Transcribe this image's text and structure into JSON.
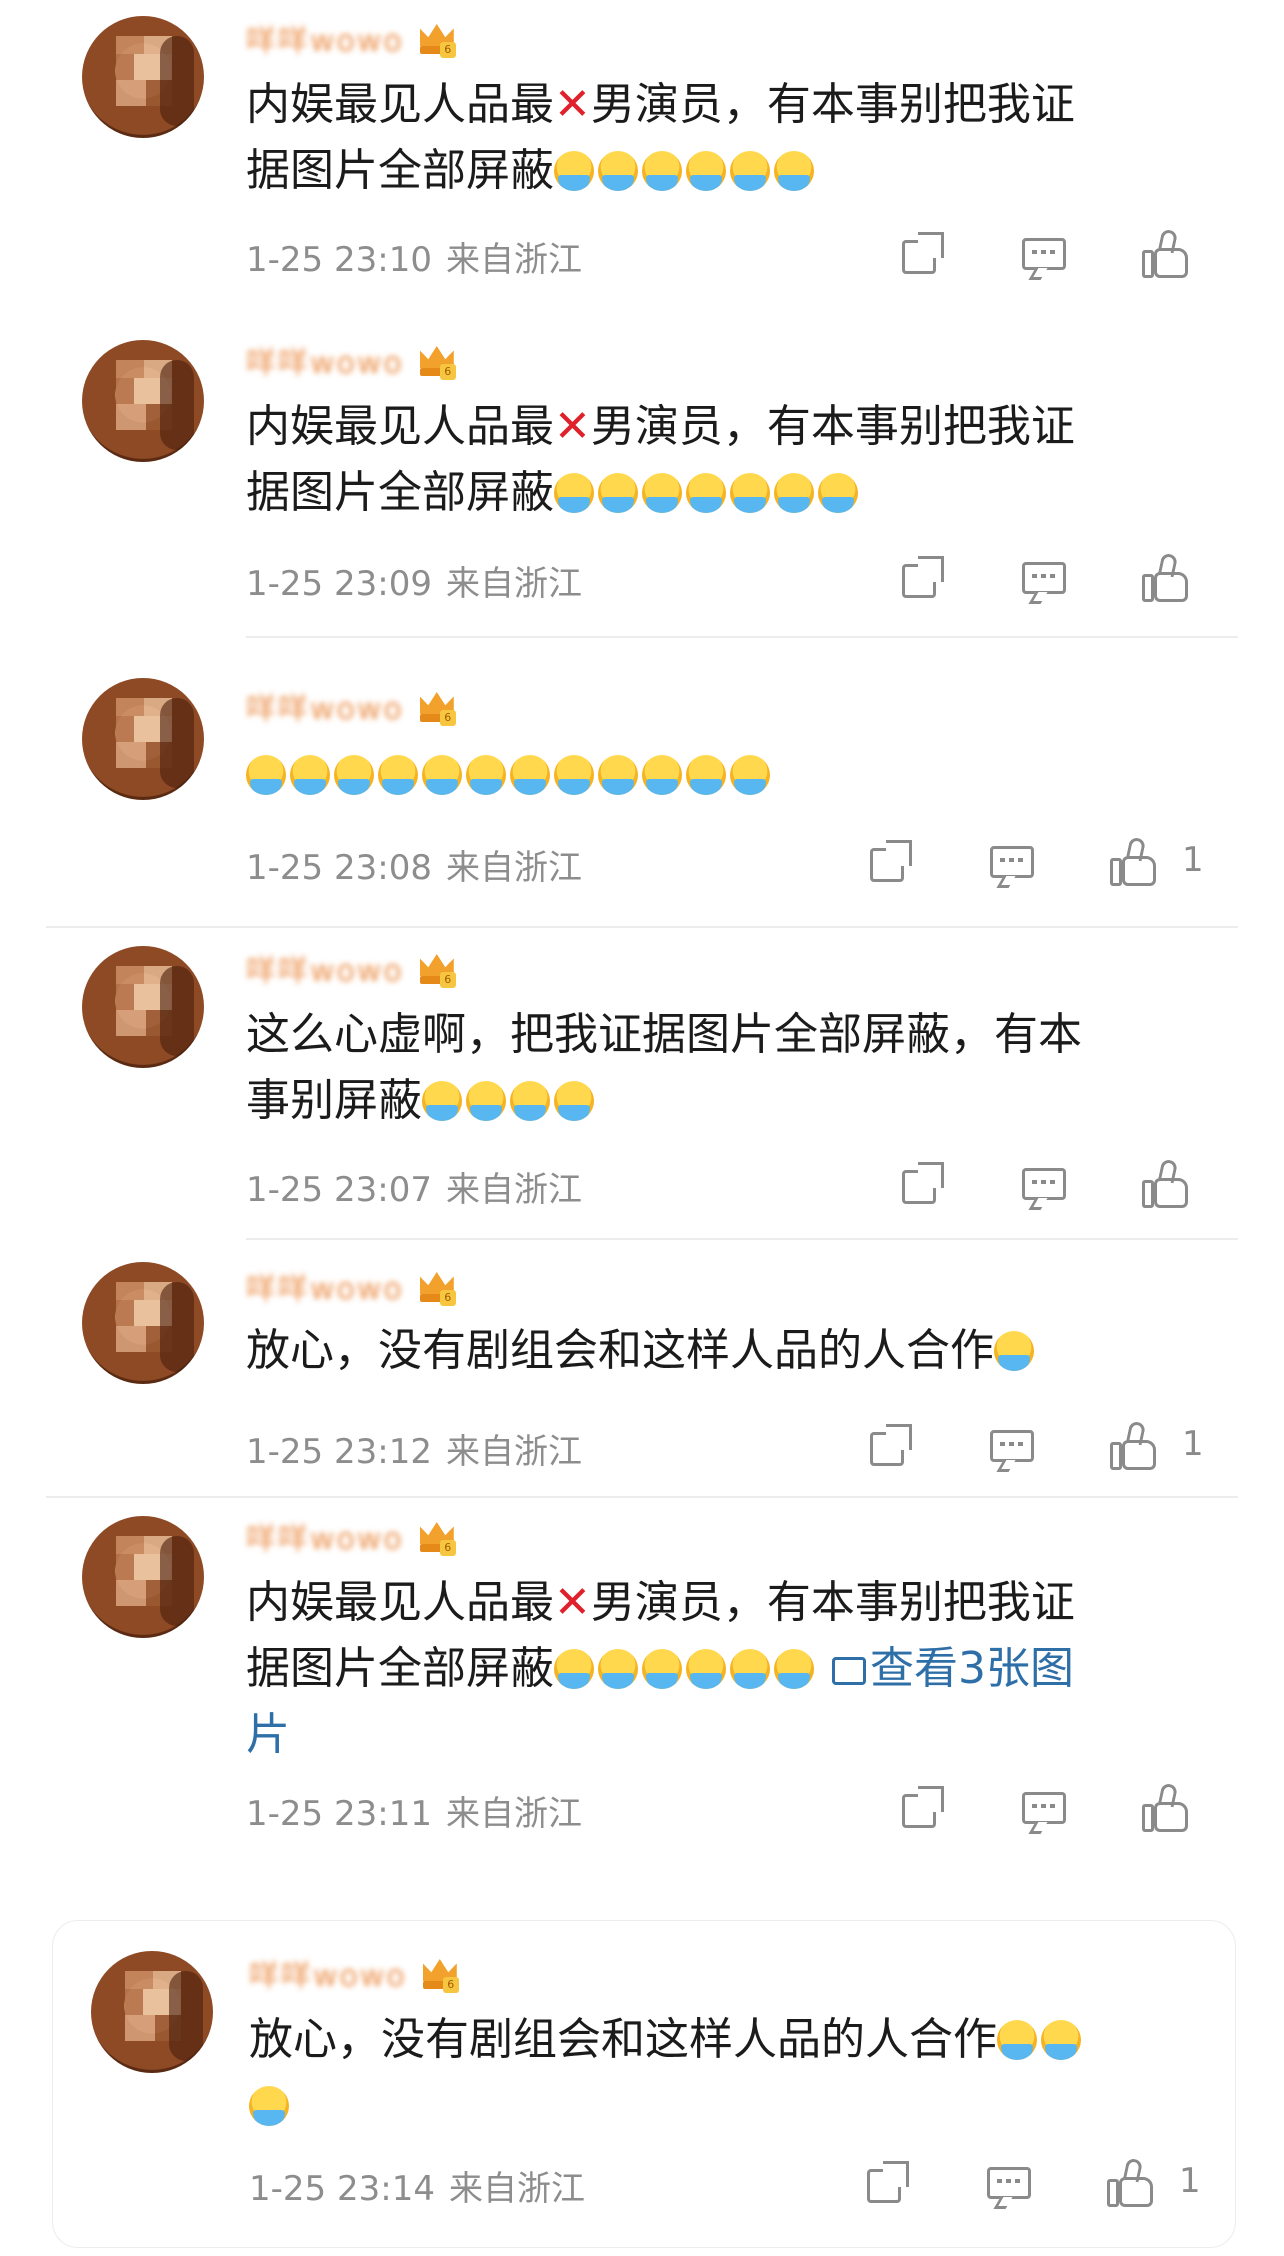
{
  "comments": [
    {
      "user": "咩咩wowo",
      "text": [
        "内娱最见人品最",
        "✕",
        "男演员，有本事别把我证",
        "据图片全部屏蔽"
      ],
      "emoji_count": 6,
      "time": "1-25 23:10",
      "location": "来自浙江",
      "likes": ""
    },
    {
      "user": "咩咩wowo",
      "text": [
        "内娱最见人品最",
        "✕",
        "男演员，有本事别把我证",
        "据图片全部屏蔽"
      ],
      "emoji_count": 7,
      "time": "1-25 23:09",
      "location": "来自浙江",
      "likes": ""
    },
    {
      "user": "咩咩wowo",
      "text": [
        ""
      ],
      "emoji_count": 12,
      "time": "1-25 23:08",
      "location": "来自浙江",
      "likes": "1"
    },
    {
      "user": "咩咩wowo",
      "text": [
        "这么心虚啊，把我证据图片全部屏蔽，有本",
        "事别屏蔽"
      ],
      "emoji_count": 4,
      "time": "1-25 23:07",
      "location": "来自浙江",
      "likes": ""
    },
    {
      "user": "咩咩wowo",
      "text": [
        "放心，没有剧组会和这样人品的人合作"
      ],
      "emoji_count": 1,
      "time": "1-25 23:12",
      "location": "来自浙江",
      "likes": "1"
    },
    {
      "user": "咩咩wowo",
      "text": [
        "内娱最见人品最",
        "✕",
        "男演员，有本事别把我证",
        "据图片全部屏蔽"
      ],
      "emoji_count": 6,
      "link": "查看3张图",
      "link_tail": "片",
      "time": "1-25 23:11",
      "location": "来自浙江",
      "likes": ""
    },
    {
      "user": "咩咩wowo",
      "text": [
        "放心，没有剧组会和这样人品的人合作"
      ],
      "emoji_count": 3,
      "time": "1-25 23:14",
      "location": "来自浙江",
      "likes": "1"
    }
  ],
  "icons": {
    "share": "share-icon",
    "comment": "comment-icon",
    "like": "like-icon",
    "badge": "crown-badge-icon"
  },
  "colors": {
    "username": "#e77b2a",
    "meta": "#8d8d8d",
    "link": "#2f6fa8",
    "xmark": "#e0202b"
  }
}
